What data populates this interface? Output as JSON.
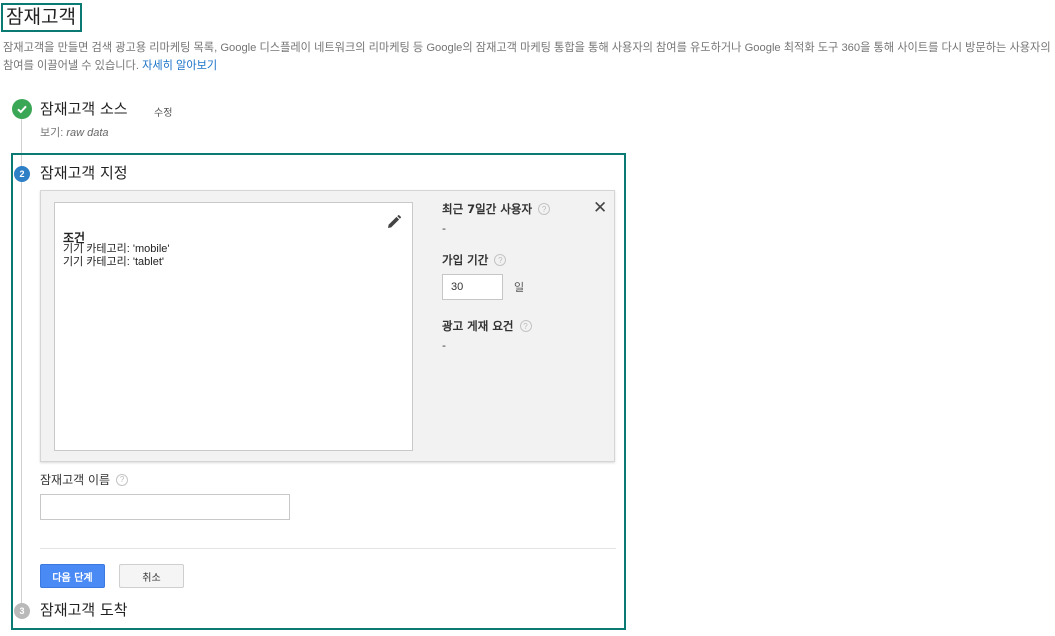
{
  "page": {
    "title": "잠재고객",
    "description": "잠재고객을 만들면 검색 광고용 리마케팅 목록, Google 디스플레이 네트워크의 리마케팅 등 Google의 잠재고객 마케팅 통합을 통해 사용자의 참여를 유도하거나 Google 최적화 도구 360을 통해 사이트를 다시 방문하는 사용자의 참여를 이끌어낼 수 있습니다.",
    "learn_more": "자세히 알아보기"
  },
  "steps": {
    "step1": {
      "title": "잠재고객 소스",
      "edit": "수정",
      "view_label": "보기:",
      "view_value": "raw data"
    },
    "step2": {
      "number": "2",
      "title": "잠재고객 지정"
    },
    "step3": {
      "number": "3",
      "title": "잠재고객 도착"
    }
  },
  "conditions": {
    "heading": "조건",
    "lines": [
      "기기 카테고리: 'mobile'",
      "기기 카테고리: 'tablet'"
    ]
  },
  "side": {
    "users_label": "최근 7일간 사용자",
    "users_value": "-",
    "membership_label": "가입 기간",
    "membership_value": "30",
    "membership_unit": "일",
    "eligibility_label": "광고 게재 요건",
    "eligibility_value": "-",
    "help_glyph": "?",
    "close_glyph": "✕"
  },
  "audience_name": {
    "label": "잠재고객 이름",
    "value": ""
  },
  "buttons": {
    "next": "다음 단계",
    "cancel": "취소"
  },
  "colors": {
    "highlight": "#0b7a72",
    "primary": "#4a8af4",
    "check": "#3aa757",
    "link": "#1a73c8"
  }
}
